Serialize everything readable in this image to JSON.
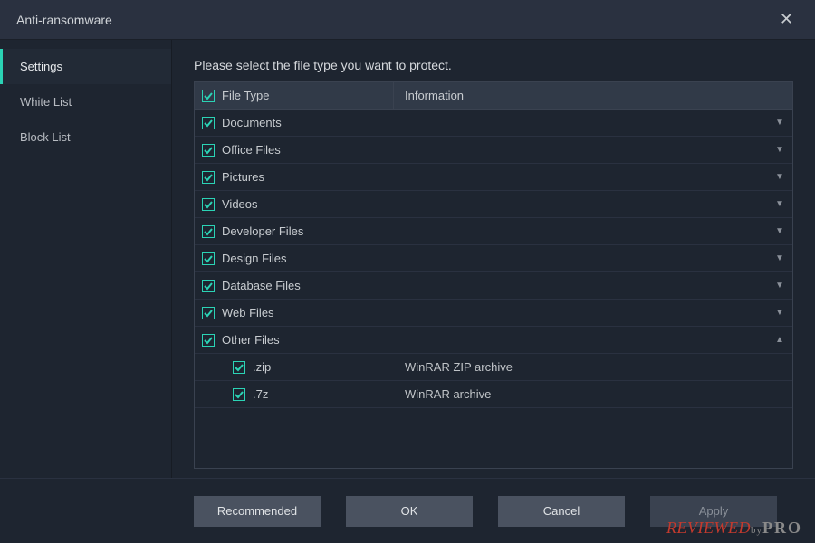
{
  "window": {
    "title": "Anti-ransomware",
    "accent": "#2bd3b5"
  },
  "sidebar": {
    "items": [
      {
        "label": "Settings",
        "active": true
      },
      {
        "label": "White List",
        "active": false
      },
      {
        "label": "Block List",
        "active": false
      }
    ]
  },
  "main": {
    "instruction": "Please select the file type you want to protect.",
    "columns": {
      "col1": "File Type",
      "col2": "Information"
    },
    "header_checked": true,
    "rows": [
      {
        "label": "Documents",
        "checked": true,
        "expandable": true,
        "expanded": false,
        "info": ""
      },
      {
        "label": "Office Files",
        "checked": true,
        "expandable": true,
        "expanded": false,
        "info": ""
      },
      {
        "label": "Pictures",
        "checked": true,
        "expandable": true,
        "expanded": false,
        "info": ""
      },
      {
        "label": "Videos",
        "checked": true,
        "expandable": true,
        "expanded": false,
        "info": ""
      },
      {
        "label": "Developer Files",
        "checked": true,
        "expandable": true,
        "expanded": false,
        "info": ""
      },
      {
        "label": "Design Files",
        "checked": true,
        "expandable": true,
        "expanded": false,
        "info": ""
      },
      {
        "label": "Database Files",
        "checked": true,
        "expandable": true,
        "expanded": false,
        "info": ""
      },
      {
        "label": "Web Files",
        "checked": true,
        "expandable": true,
        "expanded": false,
        "info": ""
      },
      {
        "label": "Other Files",
        "checked": true,
        "expandable": true,
        "expanded": true,
        "info": ""
      }
    ],
    "subrows": [
      {
        "label": ".zip",
        "checked": true,
        "info": "WinRAR ZIP archive"
      },
      {
        "label": ".7z",
        "checked": true,
        "info": "WinRAR archive"
      }
    ]
  },
  "footer": {
    "recommended": "Recommended",
    "ok": "OK",
    "cancel": "Cancel",
    "apply": "Apply",
    "apply_disabled": true
  },
  "watermark": {
    "text1": "REVIEWED",
    "by": "by",
    "text2": "PRO"
  }
}
